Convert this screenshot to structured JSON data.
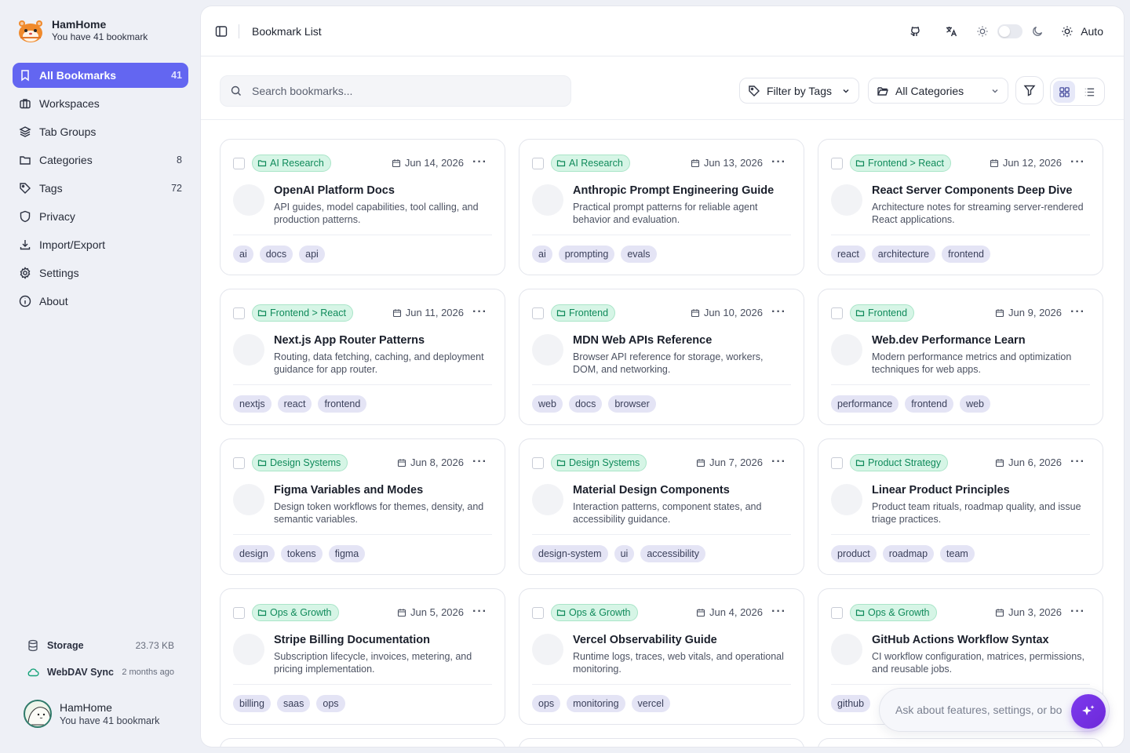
{
  "app": {
    "name": "HamHome",
    "subtitle": "You have 41 bookmark"
  },
  "nav": [
    {
      "label": "All Bookmarks",
      "count": "41",
      "icon": "bookmark-icon",
      "active": true
    },
    {
      "label": "Workspaces",
      "count": "",
      "icon": "briefcase-icon"
    },
    {
      "label": "Tab Groups",
      "count": "",
      "icon": "layers-icon"
    },
    {
      "label": "Categories",
      "count": "8",
      "icon": "folder-icon"
    },
    {
      "label": "Tags",
      "count": "72",
      "icon": "tag-icon"
    },
    {
      "label": "Privacy",
      "count": "",
      "icon": "shield-icon"
    },
    {
      "label": "Import/Export",
      "count": "",
      "icon": "download-icon"
    },
    {
      "label": "Settings",
      "count": "",
      "icon": "gear-icon"
    },
    {
      "label": "About",
      "count": "",
      "icon": "info-icon"
    }
  ],
  "storage": {
    "label": "Storage",
    "value": "23.73 KB",
    "sync_label": "WebDAV Sync",
    "sync_value": "2 months ago"
  },
  "user": {
    "name": "HamHome",
    "subtitle": "You have 41 bookmark"
  },
  "header": {
    "title": "Bookmark List",
    "theme_mode": "Auto"
  },
  "toolbar": {
    "search_placeholder": "Search bookmarks...",
    "filter_tags": "Filter by Tags",
    "categories": "All Categories"
  },
  "cards": [
    {
      "category": "AI Research",
      "date": "Jun 14, 2026",
      "title": "OpenAI Platform Docs",
      "desc": "API guides, model capabilities, tool calling, and production patterns.",
      "tags": [
        "ai",
        "docs",
        "api"
      ]
    },
    {
      "category": "AI Research",
      "date": "Jun 13, 2026",
      "title": "Anthropic Prompt Engineering Guide",
      "desc": "Practical prompt patterns for reliable agent behavior and evaluation.",
      "tags": [
        "ai",
        "prompting",
        "evals"
      ]
    },
    {
      "category": "Frontend > React",
      "date": "Jun 12, 2026",
      "title": "React Server Components Deep Dive",
      "desc": "Architecture notes for streaming server-rendered React applications.",
      "tags": [
        "react",
        "architecture",
        "frontend"
      ]
    },
    {
      "category": "Frontend > React",
      "date": "Jun 11, 2026",
      "title": "Next.js App Router Patterns",
      "desc": "Routing, data fetching, caching, and deployment guidance for app router.",
      "tags": [
        "nextjs",
        "react",
        "frontend"
      ]
    },
    {
      "category": "Frontend",
      "date": "Jun 10, 2026",
      "title": "MDN Web APIs Reference",
      "desc": "Browser API reference for storage, workers, DOM, and networking.",
      "tags": [
        "web",
        "docs",
        "browser"
      ]
    },
    {
      "category": "Frontend",
      "date": "Jun 9, 2026",
      "title": "Web.dev Performance Learn",
      "desc": "Modern performance metrics and optimization techniques for web apps.",
      "tags": [
        "performance",
        "frontend",
        "web"
      ]
    },
    {
      "category": "Design Systems",
      "date": "Jun 8, 2026",
      "title": "Figma Variables and Modes",
      "desc": "Design token workflows for themes, density, and semantic variables.",
      "tags": [
        "design",
        "tokens",
        "figma"
      ]
    },
    {
      "category": "Design Systems",
      "date": "Jun 7, 2026",
      "title": "Material Design Components",
      "desc": "Interaction patterns, component states, and accessibility guidance.",
      "tags": [
        "design-system",
        "ui",
        "accessibility"
      ]
    },
    {
      "category": "Product Strategy",
      "date": "Jun 6, 2026",
      "title": "Linear Product Principles",
      "desc": "Product team rituals, roadmap quality, and issue triage practices.",
      "tags": [
        "product",
        "roadmap",
        "team"
      ]
    },
    {
      "category": "Ops & Growth",
      "date": "Jun 5, 2026",
      "title": "Stripe Billing Documentation",
      "desc": "Subscription lifecycle, invoices, metering, and pricing implementation.",
      "tags": [
        "billing",
        "saas",
        "ops"
      ]
    },
    {
      "category": "Ops & Growth",
      "date": "Jun 4, 2026",
      "title": "Vercel Observability Guide",
      "desc": "Runtime logs, traces, web vitals, and operational monitoring.",
      "tags": [
        "ops",
        "monitoring",
        "vercel"
      ]
    },
    {
      "category": "Ops & Growth",
      "date": "Jun 3, 2026",
      "title": "GitHub Actions Workflow Syntax",
      "desc": "CI workflow configuration, matrices, permissions, and reusable jobs.",
      "tags": [
        "github"
      ]
    }
  ],
  "assistant": {
    "placeholder": "Ask about features, settings, or bo"
  },
  "colors": {
    "accent": "#6366f1",
    "category_bg": "#d6f5e6",
    "category_text": "#0f8a5a",
    "tag_bg": "#e4e4f5"
  }
}
